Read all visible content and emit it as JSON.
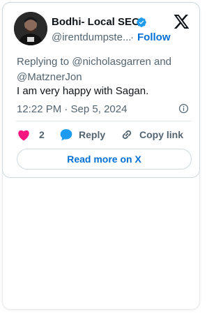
{
  "author": {
    "name": "Bodhi- Local SEO",
    "handle": "@irentdumpste...",
    "separator": "·",
    "follow_label": "Follow",
    "verified_color": "#1d9bf0"
  },
  "tweet": {
    "reply_context": "Replying to @nicholasgarren and @MatznerJon",
    "text": "I am very happy with Sagan.",
    "timestamp": "12:22 PM · Sep 5, 2024"
  },
  "actions": {
    "like_count": "2",
    "reply_label": "Reply",
    "copy_label": "Copy link"
  },
  "read_more_label": "Read more on X",
  "icons": {
    "platform": "x-logo-icon",
    "verified": "verified-badge-icon",
    "info": "info-icon",
    "like": "heart-icon",
    "reply": "speech-bubble-icon",
    "copy": "link-icon"
  },
  "colors": {
    "accent": "#006fd6",
    "like": "#f91880",
    "reply": "#1d9bf0",
    "muted": "#536471"
  }
}
